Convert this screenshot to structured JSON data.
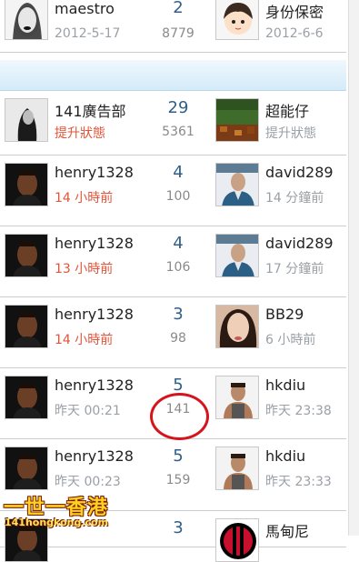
{
  "threads": [
    {
      "author": "maestro",
      "author_date": "2012-5-17",
      "author_date_style": "gray",
      "replies": "2",
      "views": "8779",
      "last_poster": "身份保密",
      "last_date": "2012-6-6",
      "last_date_style": "gray",
      "author_avatar_icon": "portrait-woman-icon",
      "last_avatar_icon": "cartoon-girl-icon"
    },
    {
      "author": "141廣告部",
      "author_date": "提升狀態",
      "author_date_style": "red",
      "replies": "29",
      "views": "5361",
      "last_poster": "超能仔",
      "last_date": "提升狀態",
      "last_date_style": "gray",
      "author_avatar_icon": "portrait-bw-icon",
      "last_avatar_icon": "pixel-scene-icon"
    },
    {
      "author": "henry1328",
      "author_date": "14 小時前",
      "author_date_style": "red",
      "replies": "4",
      "views": "100",
      "last_poster": "david289",
      "last_date": "14 分鐘前",
      "last_date_style": "gray",
      "author_avatar_icon": "portrait-man-dark-icon",
      "last_avatar_icon": "portrait-man-suit-icon"
    },
    {
      "author": "henry1328",
      "author_date": "13 小時前",
      "author_date_style": "red",
      "replies": "4",
      "views": "106",
      "last_poster": "david289",
      "last_date": "17 分鐘前",
      "last_date_style": "gray",
      "author_avatar_icon": "portrait-man-dark-icon",
      "last_avatar_icon": "portrait-man-suit-icon"
    },
    {
      "author": "henry1328",
      "author_date": "14 小時前",
      "author_date_style": "red",
      "replies": "3",
      "views": "98",
      "last_poster": "BB29",
      "last_date": "6 小時前",
      "last_date_style": "gray",
      "author_avatar_icon": "portrait-man-dark-icon",
      "last_avatar_icon": "portrait-woman-face-icon"
    },
    {
      "author": "henry1328",
      "author_date": "昨天 00:21",
      "author_date_style": "gray",
      "replies": "5",
      "views": "141",
      "last_poster": "hkdiu",
      "last_date": "昨天 23:38",
      "last_date_style": "gray",
      "author_avatar_icon": "portrait-man-dark-icon",
      "last_avatar_icon": "portrait-man-tank-icon"
    },
    {
      "author": "henry1328",
      "author_date": "昨天 00:23",
      "author_date_style": "gray",
      "replies": "5",
      "views": "159",
      "last_poster": "hkdiu",
      "last_date": "昨天 23:33",
      "last_date_style": "gray",
      "author_avatar_icon": "portrait-man-dark-icon",
      "last_avatar_icon": "portrait-man-tank-icon"
    },
    {
      "author": "",
      "author_date": "",
      "author_date_style": "gray",
      "replies": "3",
      "views": "",
      "last_poster": "馬甸尼",
      "last_date": "",
      "last_date_style": "gray",
      "author_avatar_icon": "portrait-man-dark-icon",
      "last_avatar_icon": "ac-milan-crest-icon"
    }
  ],
  "watermark": {
    "title": "一世一香港",
    "url": "141hongkong.com"
  },
  "colors": {
    "reply_count": "#2f5f8a",
    "red_date": "#e2553a",
    "gray_text": "#9aa0a6",
    "highlight_circle": "#d6141c"
  }
}
